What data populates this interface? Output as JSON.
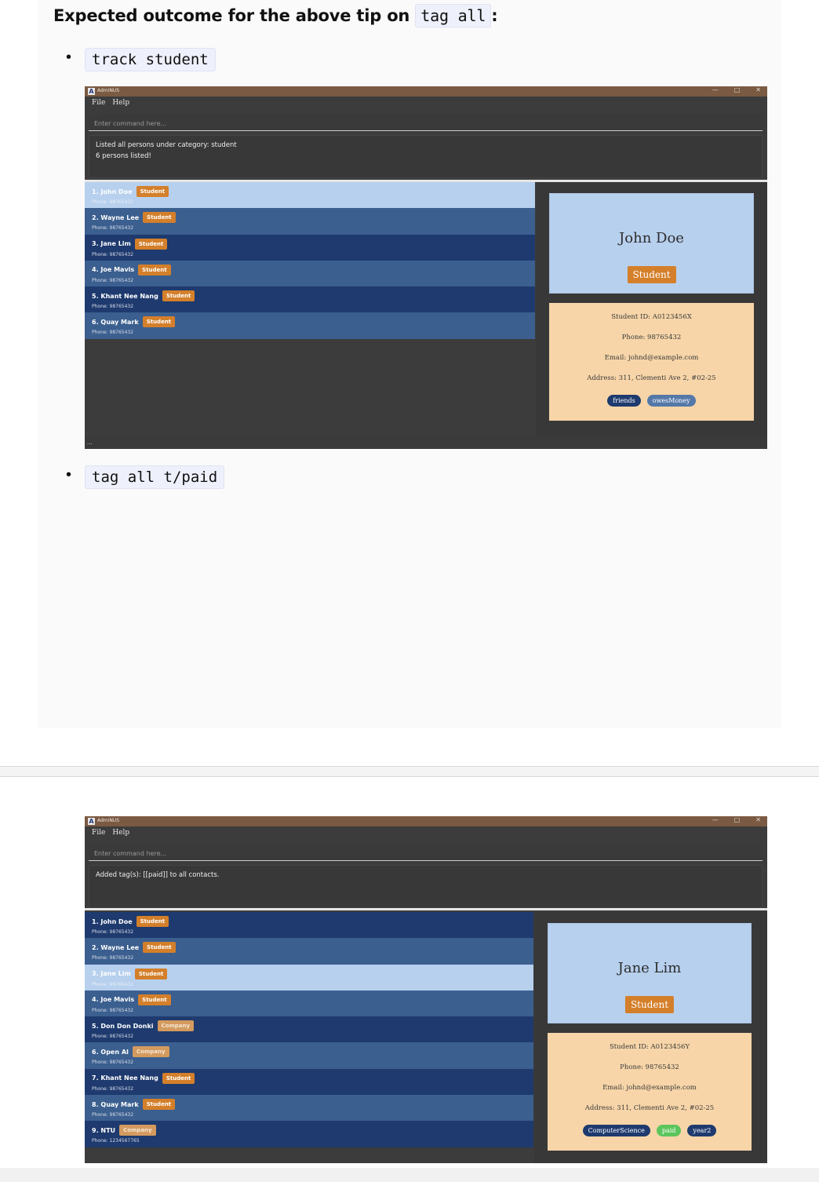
{
  "doc": {
    "heading_prefix": "Expected outcome for the above tip on",
    "heading_code": "tag all",
    "heading_suffix": ":",
    "bullet1_code": "track student",
    "bullet2_code": "tag all t/paid"
  },
  "app": {
    "title": "AdmiNUS",
    "menu": [
      "File",
      "Help"
    ],
    "command_placeholder": "Enter command here...",
    "window_controls": [
      "—",
      "□",
      "✕"
    ]
  },
  "screenshot1": {
    "result_lines": [
      "Listed all persons under category: student",
      "6 persons listed!"
    ],
    "persons": [
      {
        "index": "1.",
        "name": "John Doe",
        "tag": "Student",
        "tag_type": "student",
        "phone": "Phone: 98765432",
        "selected": true
      },
      {
        "index": "2.",
        "name": "Wayne Lee",
        "tag": "Student",
        "tag_type": "student",
        "phone": "Phone: 98765432",
        "selected": false
      },
      {
        "index": "3.",
        "name": "Jane Lim",
        "tag": "Student",
        "tag_type": "student",
        "phone": "Phone: 98765432",
        "selected": false
      },
      {
        "index": "4.",
        "name": "Joe Mavis",
        "tag": "Student",
        "tag_type": "student",
        "phone": "Phone: 98765432",
        "selected": false
      },
      {
        "index": "5.",
        "name": "Khant Nee Nang",
        "tag": "Student",
        "tag_type": "student",
        "phone": "Phone: 98765432",
        "selected": false
      },
      {
        "index": "6.",
        "name": "Quay Mark",
        "tag": "Student",
        "tag_type": "student",
        "phone": "Phone: 98765432",
        "selected": false
      }
    ],
    "detail": {
      "name": "John Doe",
      "category": "Student",
      "student_id": "Student ID: A0123456X",
      "phone": "Phone: 98765432",
      "email": "Email: johnd@example.com",
      "address": "Address: 311, Clementi Ave 2, #02-25",
      "tags": [
        {
          "label": "friends",
          "color": "#1e3a6e"
        },
        {
          "label": "owesMoney",
          "color": "#5478a8"
        }
      ]
    },
    "status": "..."
  },
  "screenshot2": {
    "result_lines": [
      "Added tag(s): [[paid]] to all contacts."
    ],
    "persons": [
      {
        "index": "1.",
        "name": "John Doe",
        "tag": "Student",
        "tag_type": "student",
        "phone": "Phone: 98765432",
        "selected": false
      },
      {
        "index": "2.",
        "name": "Wayne Lee",
        "tag": "Student",
        "tag_type": "student",
        "phone": "Phone: 98765432",
        "selected": false
      },
      {
        "index": "3.",
        "name": "Jane Lim",
        "tag": "Student",
        "tag_type": "student",
        "phone": "Phone: 98765432",
        "selected": true
      },
      {
        "index": "4.",
        "name": "Joe Mavis",
        "tag": "Student",
        "tag_type": "student",
        "phone": "Phone: 98765432",
        "selected": false
      },
      {
        "index": "5.",
        "name": "Don Don Donki",
        "tag": "Company",
        "tag_type": "company",
        "phone": "Phone: 98765432",
        "selected": false
      },
      {
        "index": "6.",
        "name": "Open AI",
        "tag": "Company",
        "tag_type": "company",
        "phone": "Phone: 98765432",
        "selected": false
      },
      {
        "index": "7.",
        "name": "Khant Nee Nang",
        "tag": "Student",
        "tag_type": "student",
        "phone": "Phone: 98765432",
        "selected": false
      },
      {
        "index": "8.",
        "name": "Quay Mark",
        "tag": "Student",
        "tag_type": "student",
        "phone": "Phone: 98765432",
        "selected": false
      },
      {
        "index": "9.",
        "name": "NTU",
        "tag": "Company",
        "tag_type": "company",
        "phone": "Phone: 1234567765",
        "selected": false
      }
    ],
    "detail": {
      "name": "Jane Lim",
      "category": "Student",
      "student_id": "Student ID: A0123456Y",
      "phone": "Phone: 98765432",
      "email": "Email: johnd@example.com",
      "address": "Address: 311, Clementi Ave 2, #02-25",
      "tags": [
        {
          "label": "ComputerScience",
          "color": "#1e3a6e"
        },
        {
          "label": "paid",
          "color": "#5cc55c"
        },
        {
          "label": "year2",
          "color": "#1e3a6e"
        }
      ]
    }
  }
}
